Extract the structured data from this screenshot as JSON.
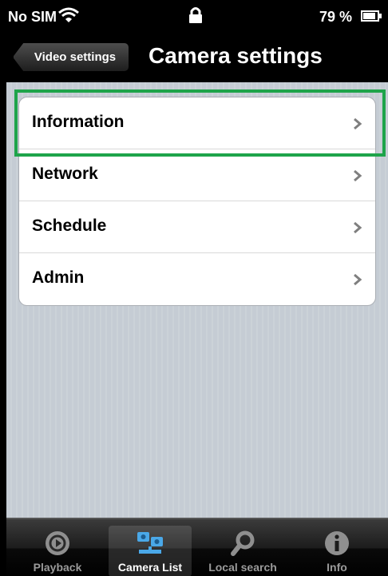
{
  "status_bar": {
    "carrier": "No SIM",
    "battery": "79 %"
  },
  "nav": {
    "back_label": "Video settings",
    "title": "Camera settings"
  },
  "rows": [
    {
      "label": "Information"
    },
    {
      "label": "Network"
    },
    {
      "label": "Schedule"
    },
    {
      "label": "Admin"
    }
  ],
  "tabs": [
    {
      "label": "Playback",
      "icon": "playback-icon"
    },
    {
      "label": "Camera List",
      "icon": "camera-list-icon"
    },
    {
      "label": "Local search",
      "icon": "search-icon"
    },
    {
      "label": "Info",
      "icon": "info-icon"
    }
  ],
  "colors": {
    "highlight": "#1ea44a",
    "tab_active_icon": "#4aa8e8"
  }
}
